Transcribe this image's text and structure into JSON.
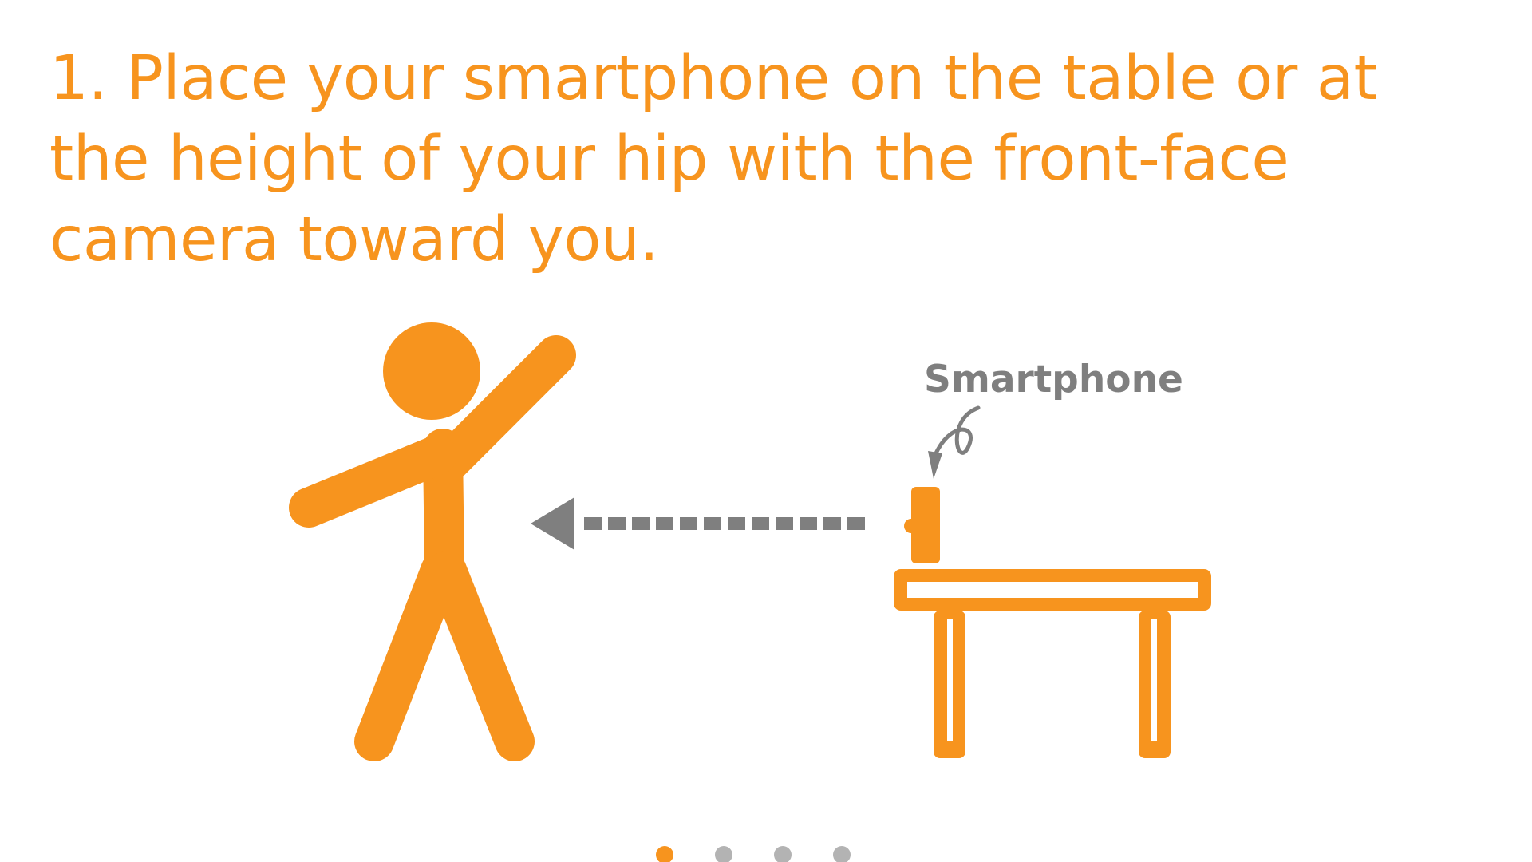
{
  "instruction": {
    "text": "1. Place your smartphone on the table or at the height of your hip with the front-face camera toward you."
  },
  "illustration": {
    "phone_label": "Smartphone",
    "colors": {
      "figure": "#f7941e",
      "arrow": "#7f7f7f",
      "label": "#7f7f7f"
    },
    "icons": [
      "stick-figure",
      "table-icon",
      "smartphone-icon",
      "dashed-arrow",
      "curved-pointer-arrow"
    ]
  },
  "pager": {
    "total": 4,
    "current": 1,
    "colors": {
      "active": "#f7941e",
      "inactive": "#b3b3b3"
    }
  }
}
